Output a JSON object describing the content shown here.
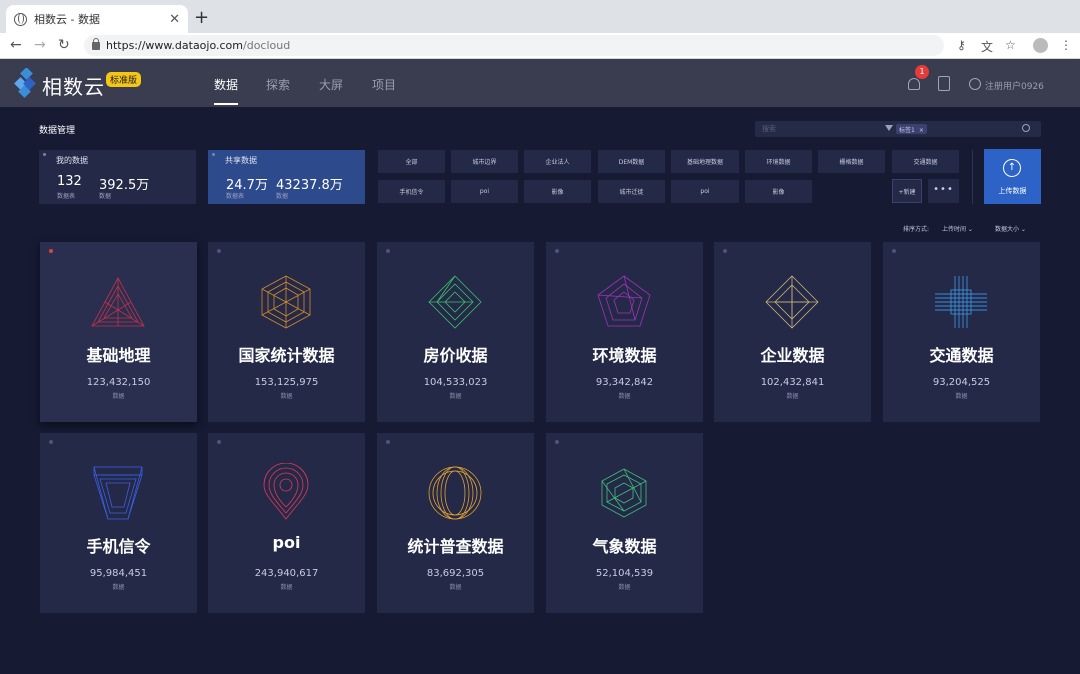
{
  "browser": {
    "tab_title": "相数云 - 数据",
    "url_domain": "https://www.dataojo.com",
    "url_path": "/docloud"
  },
  "app": {
    "name": "相数云",
    "edition": "标准版",
    "nav": [
      "数据",
      "探索",
      "大屏",
      "项目"
    ],
    "notification_count": "1",
    "user": "注册用户0926"
  },
  "main": {
    "section_title": "数据管理",
    "search_placeholder": "搜索",
    "filter_tag": "标签1",
    "my_data": {
      "label": "我的数据",
      "tables": "132",
      "tables_unit": "数据表",
      "records": "392.5万",
      "records_unit": "数据"
    },
    "shared_data": {
      "label": "共享数据",
      "tables": "24.7万",
      "tables_unit": "数据表",
      "records": "43237.8万",
      "records_unit": "数据"
    },
    "filters_row1": [
      "全部",
      "城市边界",
      "企业法人",
      "DEM数据",
      "基础地理数据",
      "环境数据",
      "栅格数据",
      "交通数据"
    ],
    "filters_row2": [
      "手机信令",
      "poi",
      "影像",
      "城市迁徙",
      "poi",
      "影像"
    ],
    "new_label": "+新建",
    "more_label": "•••",
    "upload_label": "上传数据",
    "sort_label": "排序方式:",
    "sort_time": "上传时间 ⌄",
    "sort_size": "数据大小 ⌄",
    "cards": [
      {
        "name": "基础地理",
        "count": "123,432,150",
        "unit": "数据",
        "icon": "triangle-icon",
        "color": "#c0314a"
      },
      {
        "name": "国家统计数据",
        "count": "153,125,975",
        "unit": "数据",
        "icon": "hexagon-cube-icon",
        "color": "#d48a2a"
      },
      {
        "name": "房价收据",
        "count": "104,533,023",
        "unit": "数据",
        "icon": "diamond-icon",
        "color": "#3bbf6a"
      },
      {
        "name": "环境数据",
        "count": "93,342,842",
        "unit": "数据",
        "icon": "pentagon-icon",
        "color": "#a333b8"
      },
      {
        "name": "企业数据",
        "count": "102,432,841",
        "unit": "数据",
        "icon": "diamond-gold-icon",
        "color": "#c9b27a"
      },
      {
        "name": "交通数据",
        "count": "93,204,525",
        "unit": "数据",
        "icon": "cross-grid-icon",
        "color": "#3a8fd8"
      },
      {
        "name": "手机信令",
        "count": "95,984,451",
        "unit": "数据",
        "icon": "funnel-icon",
        "color": "#3b5fe0"
      },
      {
        "name": "poi",
        "count": "243,940,617",
        "unit": "数据",
        "icon": "map-pin-icon",
        "color": "#e03a5a"
      },
      {
        "name": "统计普查数据",
        "count": "83,692,305",
        "unit": "数据",
        "icon": "ring-icon",
        "color": "#e0a030"
      },
      {
        "name": "气象数据",
        "count": "52,104,539",
        "unit": "数据",
        "icon": "hexagon-icon",
        "color": "#3fbf7a"
      }
    ]
  }
}
